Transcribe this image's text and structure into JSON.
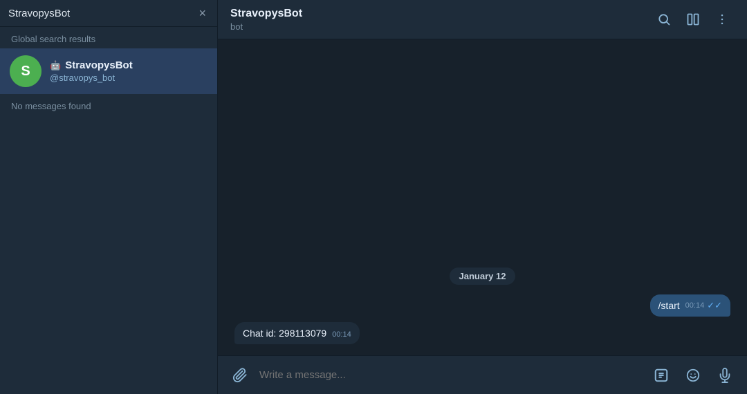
{
  "left_panel": {
    "search_value": "StravopysBot",
    "close_label": "×",
    "section_label": "Global search results",
    "result": {
      "avatar_letter": "S",
      "bot_icon": "🤖",
      "name": "StravopysBot",
      "username": "@stravopys_bot"
    },
    "no_messages": "No messages found"
  },
  "right_panel": {
    "header": {
      "name": "StravopysBot",
      "status": "bot",
      "search_icon": "🔍",
      "columns_icon": "⊞",
      "more_icon": "⋮"
    },
    "date_divider": "January 12",
    "messages": [
      {
        "id": "msg-out-1",
        "direction": "out",
        "text": "/start",
        "time": "00:14",
        "ticks": "✓✓"
      },
      {
        "id": "msg-in-1",
        "direction": "in",
        "text": "Chat id: 298113079",
        "time": "00:14"
      }
    ],
    "input_bar": {
      "attach_icon": "📎",
      "placeholder": "Write a message...",
      "commands_icon": "/",
      "emoji_icon": "🙂",
      "mic_icon": "🎤"
    }
  }
}
